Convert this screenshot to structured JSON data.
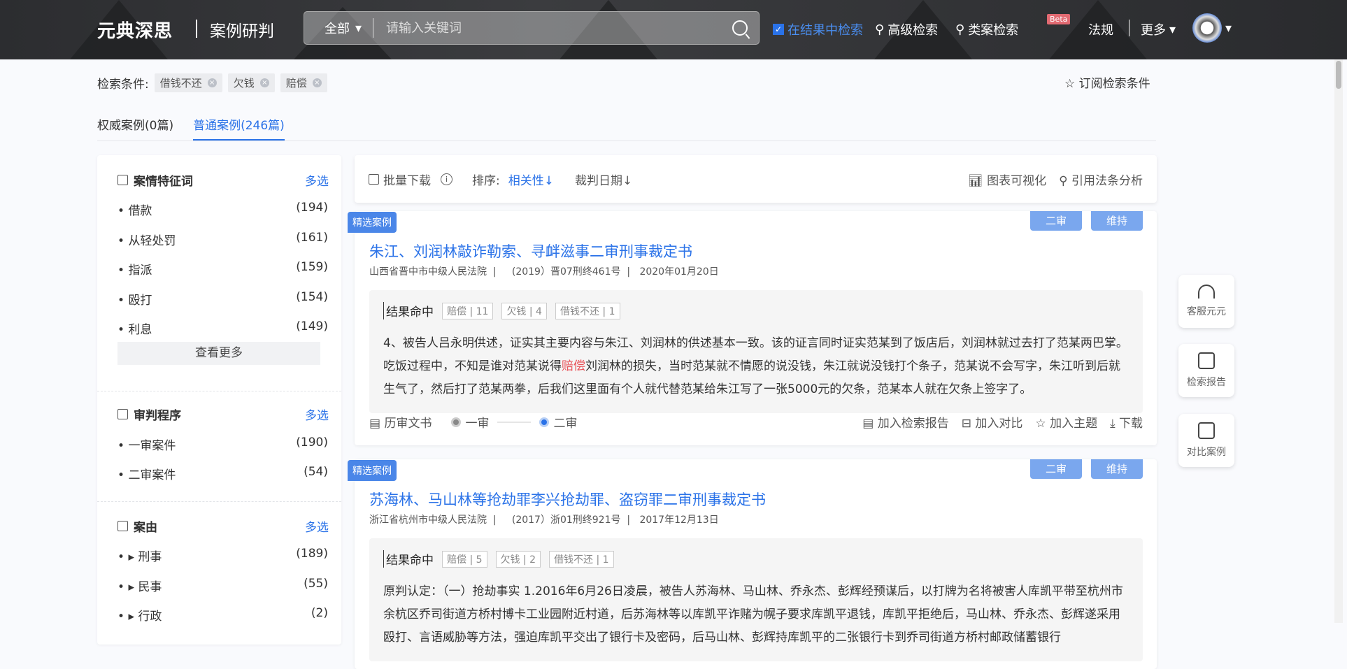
{
  "header": {
    "logo": "元典深思",
    "product": "案例研判",
    "search_scope": "全部",
    "search_placeholder": "请输入关键词",
    "in_results": "在结果中检索",
    "advanced": "高级检索",
    "similar": "类案检索",
    "beta": "Beta",
    "law": "法规",
    "more": "更多"
  },
  "conditions": {
    "label": "检索条件:",
    "tags": [
      "借钱不还",
      "欠钱",
      "赔偿"
    ],
    "subscribe": "订阅检索条件"
  },
  "tabs": [
    {
      "label": "权威案例(0篇)"
    },
    {
      "label": "普通案例(246篇)",
      "active": true
    }
  ],
  "sidebar": {
    "multi": "多选",
    "more": "查看更多",
    "sections": [
      {
        "title": "案情特征词",
        "items": [
          {
            "label": "借款",
            "count": "(194)"
          },
          {
            "label": "从轻处罚",
            "count": "(161)"
          },
          {
            "label": "指派",
            "count": "(159)"
          },
          {
            "label": "殴打",
            "count": "(154)"
          },
          {
            "label": "利息",
            "count": "(149)"
          }
        ]
      },
      {
        "title": "审判程序",
        "items": [
          {
            "label": "一审案件",
            "count": "(190)"
          },
          {
            "label": "二审案件",
            "count": "(54)"
          }
        ]
      },
      {
        "title": "案由",
        "items": [
          {
            "label": "刑事",
            "count": "(189)"
          },
          {
            "label": "民事",
            "count": "(55)"
          },
          {
            "label": "行政",
            "count": "(2)"
          }
        ]
      }
    ]
  },
  "toolbar": {
    "batch": "批量下载",
    "sort_label": "排序:",
    "sort_rel": "相关性↓",
    "sort_date": "裁判日期↓",
    "chart": "图表可视化",
    "law_analysis": "引用法条分析"
  },
  "cards": [
    {
      "badge": "精选案例",
      "tag1": "二审",
      "tag2": "维持",
      "title": "朱江、刘润林敲诈勒索、寻衅滋事二审刑事裁定书",
      "meta": "山西省晋中市中级人民法院  |     (2019）晋07刑终461号  |   2020年01月20日",
      "hit_label": "结果命中",
      "hits": [
        "赔偿 | 11",
        "欠钱 | 4",
        "借钱不还 | 1"
      ],
      "text_a": "4、被告人吕永明供述，证实其主要内容与朱江、刘润林的供述基本一致。该的证言同时证实范某到了饭店后，刘润林就过去打了范某两巴掌。吃饭过程中，不知是谁对范某说得",
      "text_hl": "赔偿",
      "text_b": "刘润林的损失，当时范某就不情愿的说没钱，朱江就说没钱打个条子，范某说不会写字，朱江听到后就生气了，然后打了范某两拳，后我们这里面有个人就代替范某给朱江写了一张5000元的欠条，范某本人就在欠条上签字了。"
    },
    {
      "badge": "精选案例",
      "tag1": "二审",
      "tag2": "维持",
      "title": "苏海林、马山林等抢劫罪李兴抢劫罪、盗窃罪二审刑事裁定书",
      "meta": "浙江省杭州市中级人民法院  |     (2017）浙01刑终921号  |   2017年12月13日",
      "hit_label": "结果命中",
      "hits": [
        "赔偿 | 5",
        "欠钱 | 2",
        "借钱不还 | 1"
      ],
      "text_a": "原判认定：（一）抢劫事实 1.2016年6月26日凌晨，被告人苏海林、马山林、乔永杰、彭辉经预谋后，以打牌为名将被害人库凯平带至杭州市余杭区乔司街道方桥村博卡工业园附近村道，后苏海林等以库凯平诈赌为幌子要求库凯平退钱，库凯平拒绝后，马山林、乔永杰、彭辉遂采用殴打、言语威胁等方法，强迫库凯平交出了银行卡及密码，后马山林、彭辉持库凯平的二张银行卡到乔司街道方桥村邮政储蓄银行",
      "text_hl": "",
      "text_b": ""
    }
  ],
  "card_footer": {
    "history": "历审文书",
    "first": "一审",
    "second": "二审",
    "add_report": "加入检索报告",
    "add_compare": "加入对比",
    "add_topic": "加入主题",
    "download": "下载"
  },
  "float": [
    "客服元元",
    "检索报告",
    "对比案例"
  ]
}
